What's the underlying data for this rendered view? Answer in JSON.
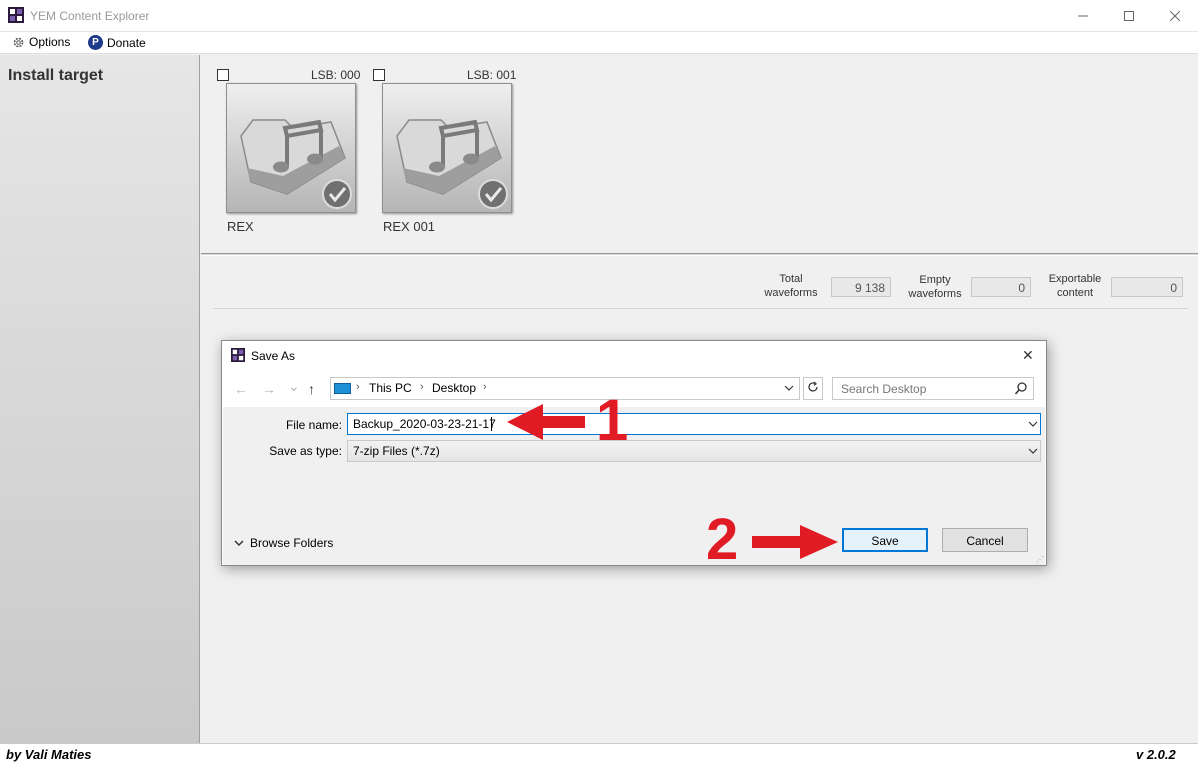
{
  "window": {
    "title": "YEM Content Explorer",
    "minimize_glyph": "—",
    "maximize_glyph": "☐",
    "close_glyph": "✕"
  },
  "menu": {
    "options": "Options",
    "donate": "Donate",
    "options_icon": "gear-icon",
    "donate_icon": "paypal-icon",
    "donate_badge": "P"
  },
  "sidebar": {
    "heading": "Install target"
  },
  "devices": [
    {
      "lsb": "LSB: 000",
      "name": "REX",
      "checked": false
    },
    {
      "lsb": "LSB: 001",
      "name": "REX 001",
      "checked": false
    }
  ],
  "stats": [
    {
      "label_line1": "Total",
      "label_line2": "waveforms",
      "value": "9 138"
    },
    {
      "label_line1": "Empty",
      "label_line2": "waveforms",
      "value": "0"
    },
    {
      "label_line1": "Exportable",
      "label_line2": "content",
      "value": "0"
    }
  ],
  "dialog": {
    "title": "Save As",
    "close_glyph": "✕",
    "nav": {
      "back": "←",
      "forward": "→",
      "recent": "⌄",
      "up": "↑"
    },
    "breadcrumb": [
      "This PC",
      "Desktop"
    ],
    "search_placeholder": "Search Desktop",
    "file_name_label": "File name:",
    "file_name_value": "Backup_2020-03-23-21-17",
    "save_type_label": "Save as type:",
    "save_type_value": "7-zip Files (*.7z)",
    "browse_folders": "Browse Folders",
    "save_button": "Save",
    "cancel_button": "Cancel"
  },
  "annotations": {
    "step1": "1",
    "step2": "2",
    "color": "#e01b24"
  },
  "footer": {
    "credit": "by Vali Maties",
    "version": "v 2.0.2"
  }
}
